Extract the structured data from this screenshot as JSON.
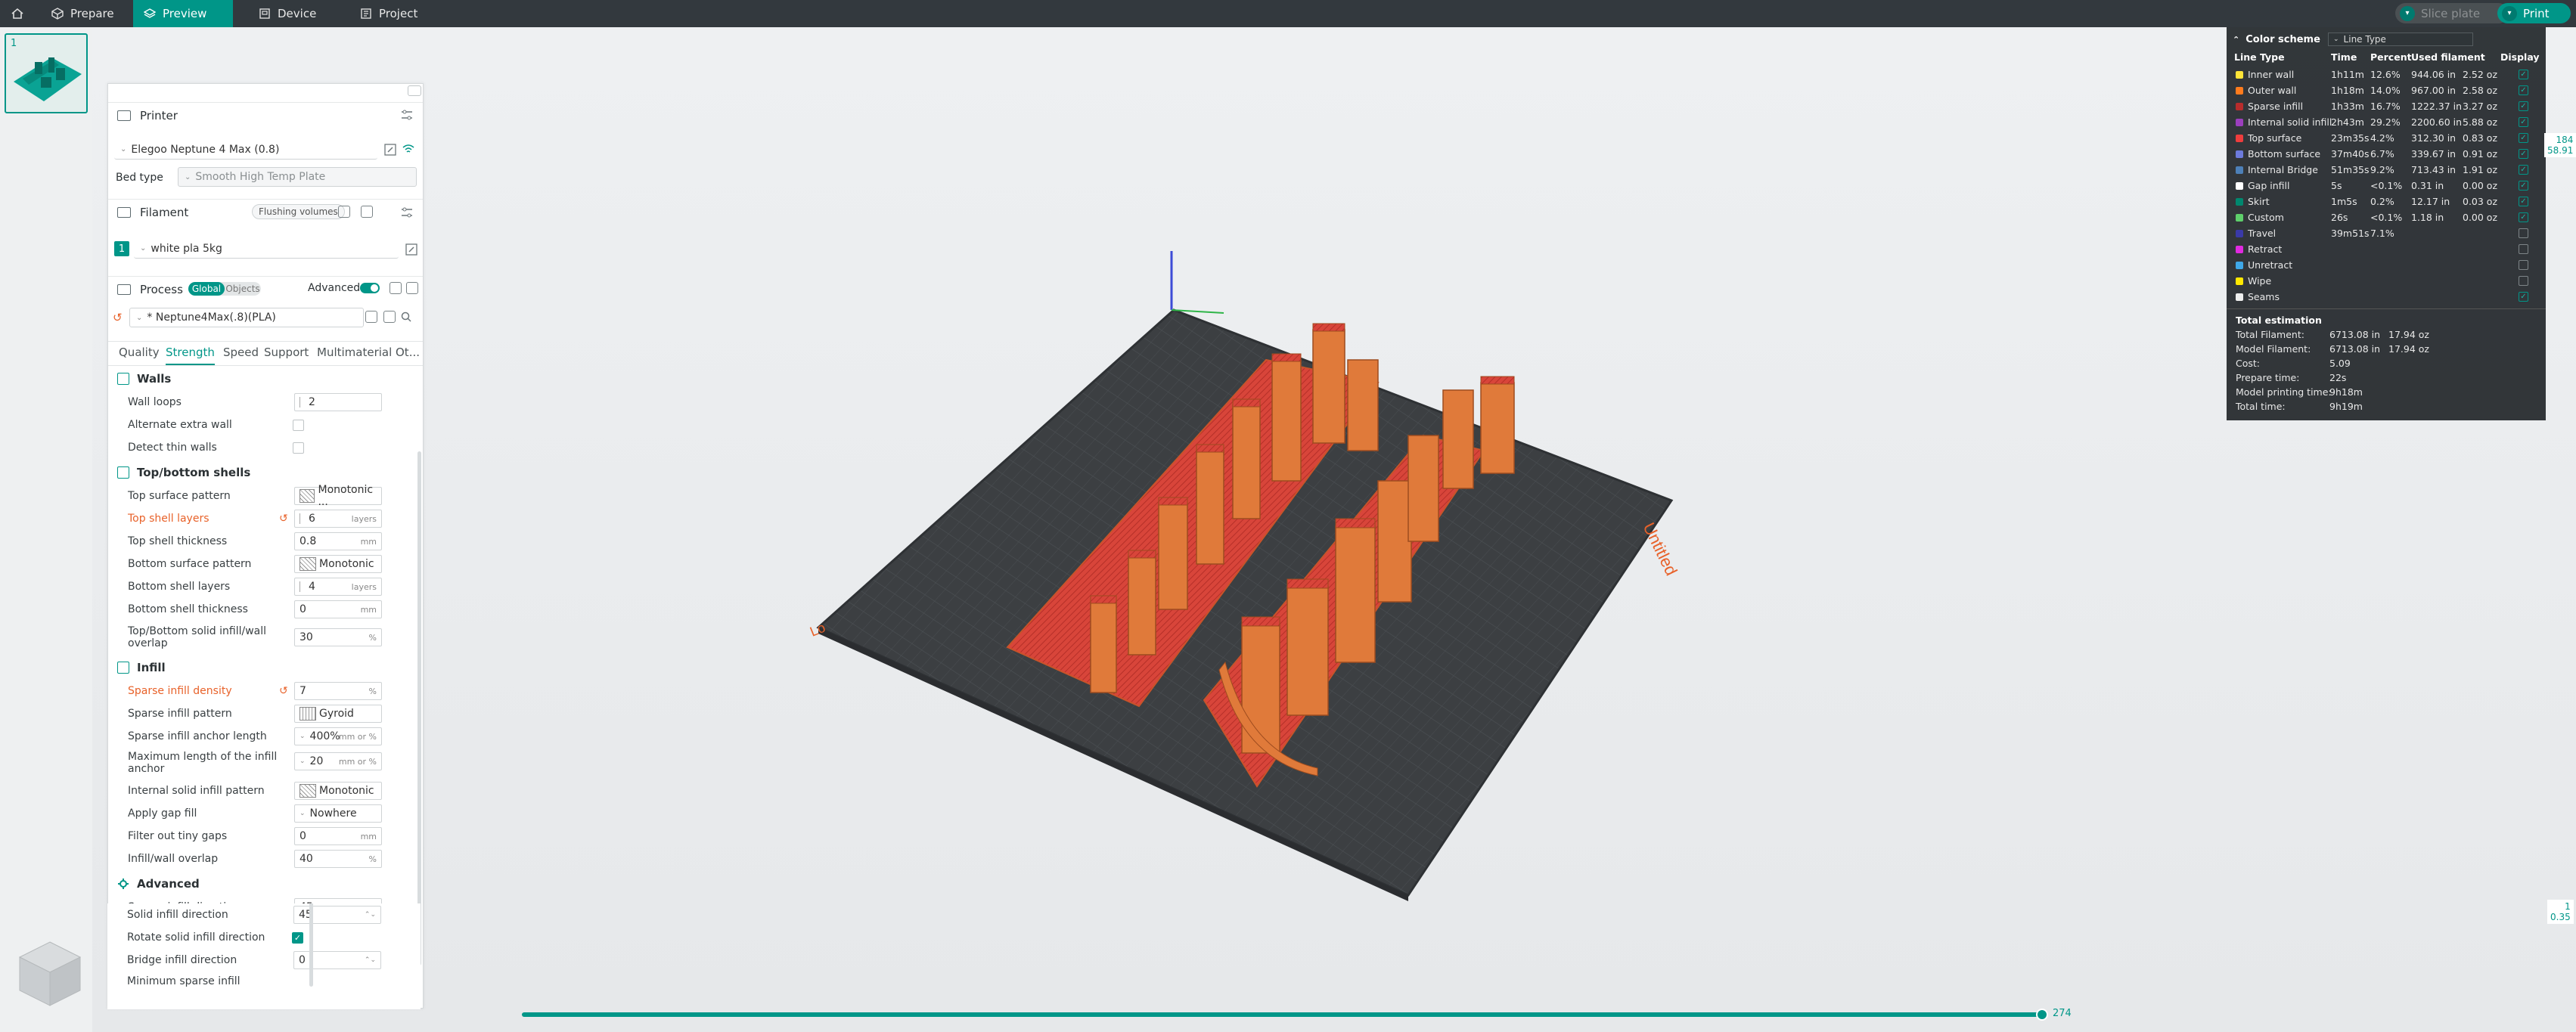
{
  "topbar": {
    "tabs": [
      {
        "label": "Prepare",
        "icon": "prepare-icon"
      },
      {
        "label": "Preview",
        "icon": "preview-icon"
      },
      {
        "label": "Device",
        "icon": "device-icon"
      },
      {
        "label": "Project",
        "icon": "project-icon"
      }
    ],
    "active_tab": "Preview",
    "slice_label": "Slice plate",
    "print_label": "Print"
  },
  "plates": {
    "thumb_number": "1"
  },
  "printer": {
    "section_label": "Printer",
    "name": "Elegoo Neptune 4 Max (0.8)",
    "bed_type_label": "Bed type",
    "bed_type_value": "Smooth High Temp Plate"
  },
  "filament": {
    "section_label": "Filament",
    "flushing_label": "Flushing volumes",
    "slot_number": "1",
    "name": "white pla 5kg"
  },
  "process": {
    "section_label": "Process",
    "global_label": "Global",
    "objects_label": "Objects",
    "advanced_label": "Advanced",
    "preset": "* Neptune4Max(.8)(PLA)"
  },
  "tabs": [
    "Quality",
    "Strength",
    "Speed",
    "Support",
    "Multimaterial",
    "Ot..."
  ],
  "active_settings_tab": "Strength",
  "walls": {
    "title": "Walls",
    "wall_loops_label": "Wall loops",
    "wall_loops": "2",
    "alternate_extra_wall_label": "Alternate extra wall",
    "detect_thin_walls_label": "Detect thin walls"
  },
  "shells": {
    "title": "Top/bottom shells",
    "top_surface_pattern_label": "Top surface pattern",
    "top_surface_pattern": "Monotonic ...",
    "top_shell_layers_label": "Top shell layers",
    "top_shell_layers": "6",
    "top_shell_thickness_label": "Top shell thickness",
    "top_shell_thickness": "0.8",
    "bottom_surface_pattern_label": "Bottom surface pattern",
    "bottom_surface_pattern": "Monotonic",
    "bottom_shell_layers_label": "Bottom shell layers",
    "bottom_shell_layers": "4",
    "bottom_shell_thickness_label": "Bottom shell thickness",
    "bottom_shell_thickness": "0",
    "solid_overlap_label": "Top/Bottom solid infill/wall overlap",
    "solid_overlap": "30"
  },
  "infill": {
    "title": "Infill",
    "sparse_density_label": "Sparse infill density",
    "sparse_density": "7",
    "sparse_pattern_label": "Sparse infill pattern",
    "sparse_pattern": "Gyroid",
    "anchor_length_label": "Sparse infill anchor length",
    "anchor_length": "400%",
    "max_anchor_label": "Maximum length of the infill anchor",
    "max_anchor": "20",
    "internal_solid_pattern_label": "Internal solid infill pattern",
    "internal_solid_pattern": "Monotonic",
    "gap_fill_label": "Apply gap fill",
    "gap_fill": "Nowhere",
    "filter_gaps_label": "Filter out tiny gaps",
    "filter_gaps": "0",
    "wall_overlap_label": "Infill/wall overlap",
    "wall_overlap": "40"
  },
  "advanced": {
    "title": "Advanced",
    "sparse_direction_label": "Sparse infill direction",
    "sparse_direction": "45",
    "solid_direction_label": "Solid infill direction",
    "solid_direction": "45",
    "rotate_solid_label": "Rotate solid infill direction",
    "bridge_direction_label": "Bridge infill direction",
    "bridge_direction": "0",
    "min_sparse_label": "Minimum sparse infill"
  },
  "units": {
    "mm": "mm",
    "layers": "layers",
    "percent": "%",
    "mm_or_pct": "mm or %"
  },
  "legend": {
    "title": "Color scheme",
    "scheme": "Line Type",
    "headers": {
      "type": "Line Type",
      "time": "Time",
      "percent": "Percent",
      "filament": "Used filament",
      "display": "Display"
    },
    "rows": [
      {
        "name": "Inner wall",
        "color": "#ffe438",
        "time": "1h11m",
        "pct": "12.6%",
        "len": "944.06 in",
        "wt": "2.52 oz",
        "on": true
      },
      {
        "name": "Outer wall",
        "color": "#ff7b1d",
        "time": "1h18m",
        "pct": "14.0%",
        "len": "967.00 in",
        "wt": "2.58 oz",
        "on": true
      },
      {
        "name": "Sparse infill",
        "color": "#b82c2c",
        "time": "1h33m",
        "pct": "16.7%",
        "len": "1222.37 in",
        "wt": "3.27 oz",
        "on": true
      },
      {
        "name": "Internal solid infill",
        "color": "#9b3fbd",
        "time": "2h43m",
        "pct": "29.2%",
        "len": "2200.60 in",
        "wt": "5.88 oz",
        "on": true
      },
      {
        "name": "Top surface",
        "color": "#ee3d3d",
        "time": "23m35s",
        "pct": "4.2%",
        "len": "312.30 in",
        "wt": "0.83 oz",
        "on": true
      },
      {
        "name": "Bottom surface",
        "color": "#6d7bdc",
        "time": "37m40s",
        "pct": "6.7%",
        "len": "339.67 in",
        "wt": "0.91 oz",
        "on": true
      },
      {
        "name": "Internal Bridge",
        "color": "#4d80b8",
        "time": "51m35s",
        "pct": "9.2%",
        "len": "713.43 in",
        "wt": "1.91 oz",
        "on": true
      },
      {
        "name": "Gap infill",
        "color": "#ffffff",
        "time": "5s",
        "pct": "<0.1%",
        "len": "0.31 in",
        "wt": "0.00 oz",
        "on": true
      },
      {
        "name": "Skirt",
        "color": "#00876e",
        "time": "1m5s",
        "pct": "0.2%",
        "len": "12.17 in",
        "wt": "0.03 oz",
        "on": true
      },
      {
        "name": "Custom",
        "color": "#5ecf6b",
        "time": "26s",
        "pct": "<0.1%",
        "len": "1.18 in",
        "wt": "0.00 oz",
        "on": true
      },
      {
        "name": "Travel",
        "color": "#3a3aa8",
        "time": "39m51s",
        "pct": "7.1%",
        "len": "",
        "wt": "",
        "on": false
      },
      {
        "name": "Retract",
        "color": "#e02ae0",
        "time": "",
        "pct": "",
        "len": "",
        "wt": "",
        "on": false
      },
      {
        "name": "Unretract",
        "color": "#3fa8e8",
        "time": "",
        "pct": "",
        "len": "",
        "wt": "",
        "on": false
      },
      {
        "name": "Wipe",
        "color": "#ffe800",
        "time": "",
        "pct": "",
        "len": "",
        "wt": "",
        "on": false
      },
      {
        "name": "Seams",
        "color": "#eeeeee",
        "time": "",
        "pct": "",
        "len": "",
        "wt": "",
        "on": true
      }
    ],
    "estimation": {
      "title": "Total estimation",
      "total_filament_label": "Total Filament:",
      "total_filament_len": "6713.08 in",
      "total_filament_wt": "17.94 oz",
      "model_filament_label": "Model Filament:",
      "model_filament_len": "6713.08 in",
      "model_filament_wt": "17.94 oz",
      "cost_label": "Cost:",
      "cost": "5.09",
      "prepare_label": "Prepare time:",
      "prepare": "22s",
      "model_time_label": "Model printing time:",
      "model_time": "9h18m",
      "total_time_label": "Total time:",
      "total_time": "9h19m"
    }
  },
  "sliders": {
    "vertical_top_a": "184",
    "vertical_top_b": "58.91",
    "vertical_bot_a": "1",
    "vertical_bot_b": "0.35",
    "horizontal_value": "274"
  },
  "bed_labels": {
    "right": "Untitled",
    "left": "Lo"
  },
  "colors": {
    "accent": "#009688",
    "topbar": "#33393e",
    "model": "#e07030",
    "bed": "#3a3d40",
    "modified": "#e8622a"
  }
}
